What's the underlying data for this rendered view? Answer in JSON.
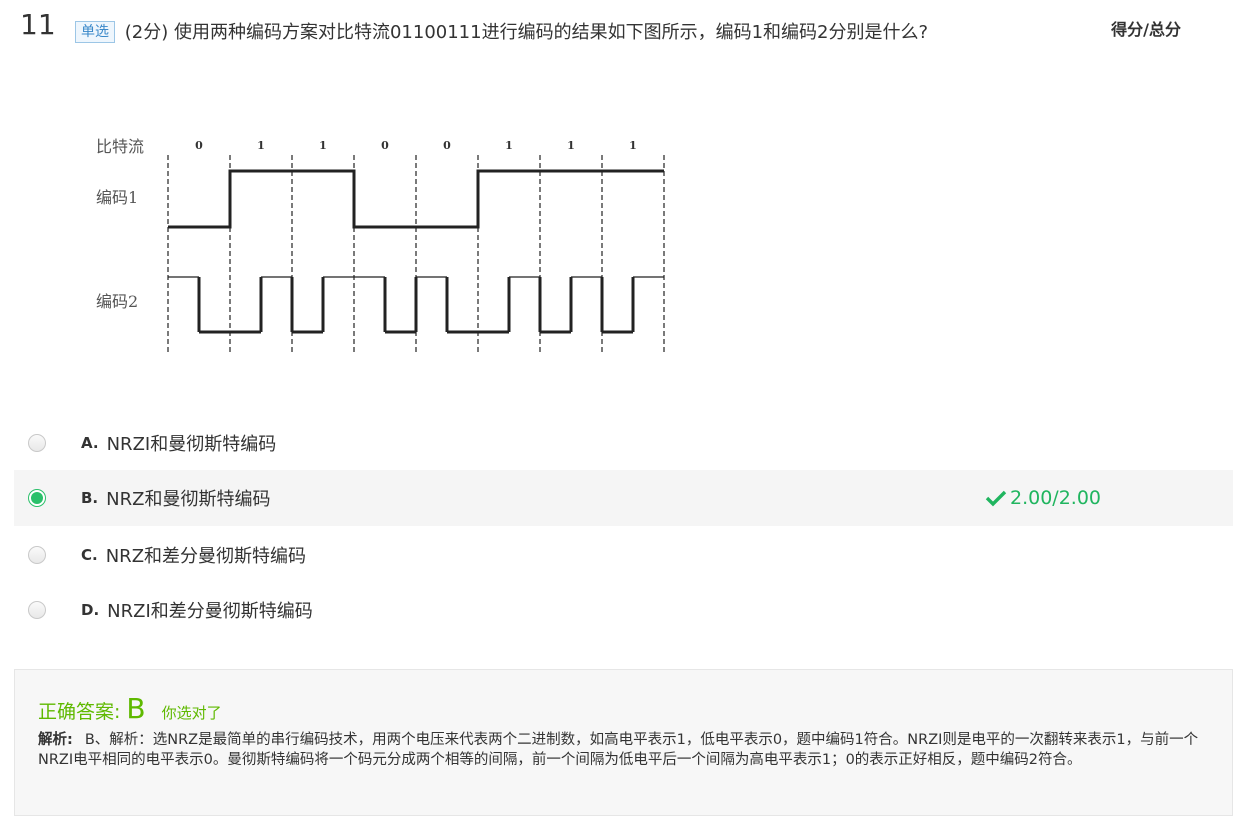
{
  "question": {
    "number": "11",
    "type_badge": "单选",
    "points": "(2分)",
    "stem": "使用两种编码方案对比特流01100111进行编码的结果如下图所示，编码1和编码2分别是什么?",
    "score_header": "得分/总分"
  },
  "figure": {
    "row_labels": [
      "比特流",
      "编码1",
      "编码2"
    ],
    "bits": [
      "0",
      "1",
      "1",
      "0",
      "0",
      "1",
      "1",
      "1"
    ]
  },
  "options": [
    {
      "letter": "A.",
      "text": "NRZI和曼彻斯特编码",
      "selected": false
    },
    {
      "letter": "B.",
      "text": "NRZ和曼彻斯特编码",
      "selected": true,
      "score": "2.00/2.00"
    },
    {
      "letter": "C.",
      "text": "NRZ和差分曼彻斯特编码",
      "selected": false
    },
    {
      "letter": "D.",
      "text": "NRZI和差分曼彻斯特编码",
      "selected": false
    }
  ],
  "answer": {
    "title": "正确答案:",
    "letter": "B",
    "note": "你选对了",
    "analysis_label": "解析:",
    "analysis_text": "B、解析：选NRZ是最简单的串行编码技术，用两个电压来代表两个二进制数，如高电平表示1，低电平表示0，题中编码1符合。NRZI则是电平的一次翻转来表示1，与前一个NRZI电平相同的电平表示0。曼彻斯特编码将一个码元分成两个相等的间隔，前一个间隔为低电平后一个间隔为高电平表示1；0的表示正好相反，题中编码2符合。"
  },
  "colors": {
    "correct": "#5fb900",
    "score_green": "#20b55f",
    "badge_blue": "#3a88c9"
  }
}
